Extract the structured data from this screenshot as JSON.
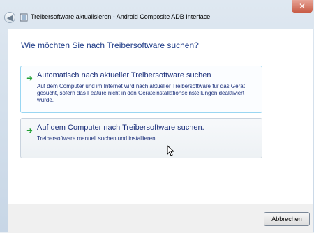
{
  "window": {
    "title": "Treibersoftware aktualisieren - Android Composite ADB Interface",
    "close_symbol": "✕",
    "back_symbol": "◀"
  },
  "content": {
    "heading": "Wie möchten Sie nach Treibersoftware suchen?",
    "options": [
      {
        "title": "Automatisch nach aktueller Treibersoftware suchen",
        "description": "Auf dem Computer und im Internet wird nach aktueller Treibersoftware für das Gerät gesucht, sofern das Feature nicht in den Geräteinstallationseinstellungen deaktiviert wurde."
      },
      {
        "title": "Auf dem Computer nach Treibersoftware suchen.",
        "description": "Treibersoftware manuell suchen und installieren."
      }
    ]
  },
  "footer": {
    "cancel_label": "Abbrechen"
  },
  "icons": {
    "arrow": "➜"
  }
}
